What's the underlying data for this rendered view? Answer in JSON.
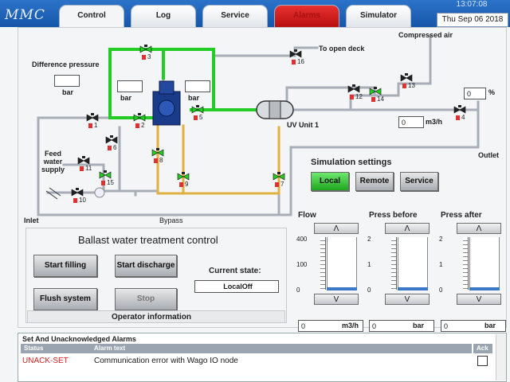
{
  "app": {
    "logo": "MMC"
  },
  "tabs": [
    {
      "label": "Control",
      "active": true
    },
    {
      "label": "Log"
    },
    {
      "label": "Service"
    },
    {
      "label": "Alarms",
      "alarm": true
    },
    {
      "label": "Simulator"
    }
  ],
  "clock": {
    "time": "13:07:08",
    "date": "Thu Sep 06 2018"
  },
  "diagram": {
    "difference_pressure_label": "Difference pressure",
    "diff_value": "",
    "diff_unit": "bar",
    "p_left_value": "",
    "p_left_unit": "bar",
    "p_right_value": "",
    "p_right_unit": "bar",
    "open_deck": "To open deck",
    "compressed_air": "Compressed air",
    "feed_water": "Feed\nwater\nsupply",
    "inlet": "Inlet",
    "outlet": "Outlet",
    "bypass": "Bypass",
    "uv_unit": "UV Unit 1",
    "percent_value": "0",
    "percent_unit": "%",
    "flow_value": "0",
    "flow_unit": "m3/h",
    "valves": [
      "1",
      "2",
      "3",
      "4",
      "5",
      "6",
      "7",
      "8",
      "9",
      "10",
      "11",
      "12",
      "13",
      "14",
      "15",
      "16"
    ]
  },
  "sim": {
    "title": "Simulation settings",
    "local": "Local",
    "remote": "Remote",
    "service": "Service"
  },
  "gauges": [
    {
      "title": "Flow",
      "ticks": [
        "400",
        "100",
        "0"
      ],
      "value": "0",
      "unit": "m3/h",
      "level": 0
    },
    {
      "title": "Press before",
      "ticks": [
        "2",
        "1",
        "0"
      ],
      "value": "0",
      "unit": "bar",
      "level": 0
    },
    {
      "title": "Press after",
      "ticks": [
        "2",
        "1",
        "0"
      ],
      "value": "0",
      "unit": "bar",
      "level": 0
    }
  ],
  "gauge_up": "Λ",
  "gauge_down": "V",
  "control": {
    "title": "Ballast water treatment control",
    "start_filling": "Start filling",
    "start_discharge": "Start discharge",
    "flush_system": "Flush system",
    "stop": "Stop",
    "current_state_label": "Current state:",
    "current_state": "LocalOff",
    "operator_info": "Operator information"
  },
  "alarms": {
    "title": "Set And Unacknowledged Alarms",
    "col_status": "Status",
    "col_text": "Alarm text",
    "col_ack": "Ack",
    "rows": [
      {
        "status": "UNACK-SET",
        "text": "Communication error with Wago IO node"
      }
    ]
  },
  "colors": {
    "green_pipe": "#22cc22",
    "yellow_pipe": "#e0b040",
    "grey_pipe": "#a8aeb8",
    "alarm_status": "#d02020"
  }
}
